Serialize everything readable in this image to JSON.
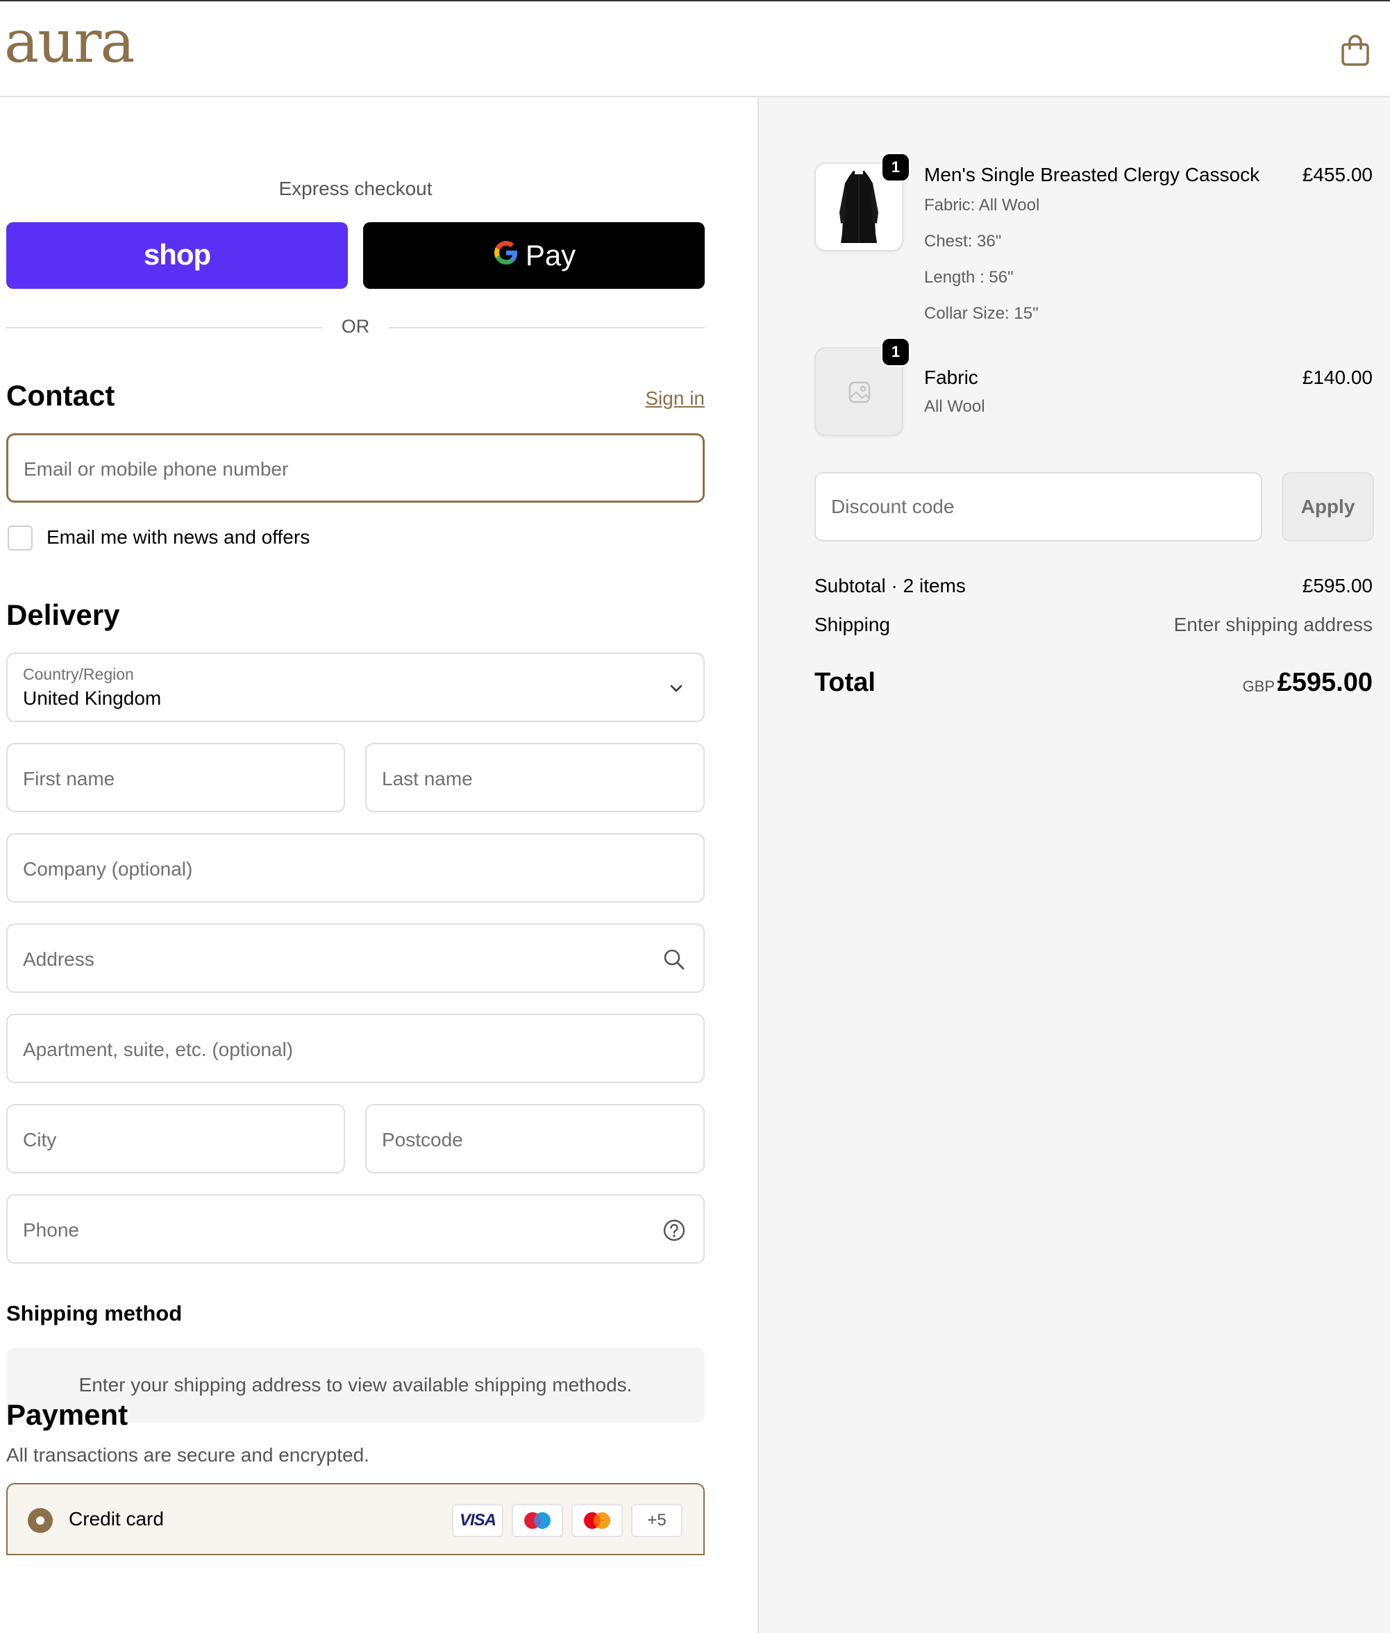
{
  "header": {
    "logo": "aura",
    "cart_icon": "shopping-bag-icon"
  },
  "express": {
    "label": "Express checkout",
    "shop_label": "shop",
    "gpay_g": "G",
    "gpay_label": "Pay",
    "or": "OR"
  },
  "contact": {
    "heading": "Contact",
    "signin": "Sign in",
    "email_placeholder": "Email or mobile phone number",
    "newsletter_label": "Email me with news and offers"
  },
  "delivery": {
    "heading": "Delivery",
    "country_label": "Country/Region",
    "country_value": "United Kingdom",
    "first_name": "First name",
    "last_name": "Last name",
    "company": "Company (optional)",
    "address": "Address",
    "apartment": "Apartment, suite, etc. (optional)",
    "city": "City",
    "postcode": "Postcode",
    "phone": "Phone"
  },
  "shipping_method": {
    "heading": "Shipping method",
    "message": "Enter your shipping address to view available shipping methods."
  },
  "payment": {
    "heading": "Payment",
    "subtitle": "All transactions are secure and encrypted.",
    "method_label": "Credit card",
    "cards": [
      "VISA",
      "maestro",
      "mastercard"
    ],
    "more_cards": "+5"
  },
  "order": {
    "items": [
      {
        "title": "Men's Single Breasted Clergy Cassock",
        "price": "£455.00",
        "quantity": "1",
        "details": [
          "Fabric: All Wool",
          "Chest: 36\"",
          "Length : 56\"",
          "Collar Size: 15\""
        ]
      },
      {
        "title": "Fabric",
        "price": "£140.00",
        "quantity": "1",
        "details": [
          "All Wool"
        ]
      }
    ],
    "discount_placeholder": "Discount code",
    "apply": "Apply",
    "subtotal_label": "Subtotal · 2 items",
    "subtotal_value": "£595.00",
    "shipping_label": "Shipping",
    "shipping_value": "Enter shipping address",
    "total_label": "Total",
    "total_currency": "GBP",
    "total_value": "£595.00"
  },
  "colors": {
    "brand": "#8b7049",
    "shop_pay": "#5a31f4",
    "panel_bg": "#f5f5f5"
  }
}
